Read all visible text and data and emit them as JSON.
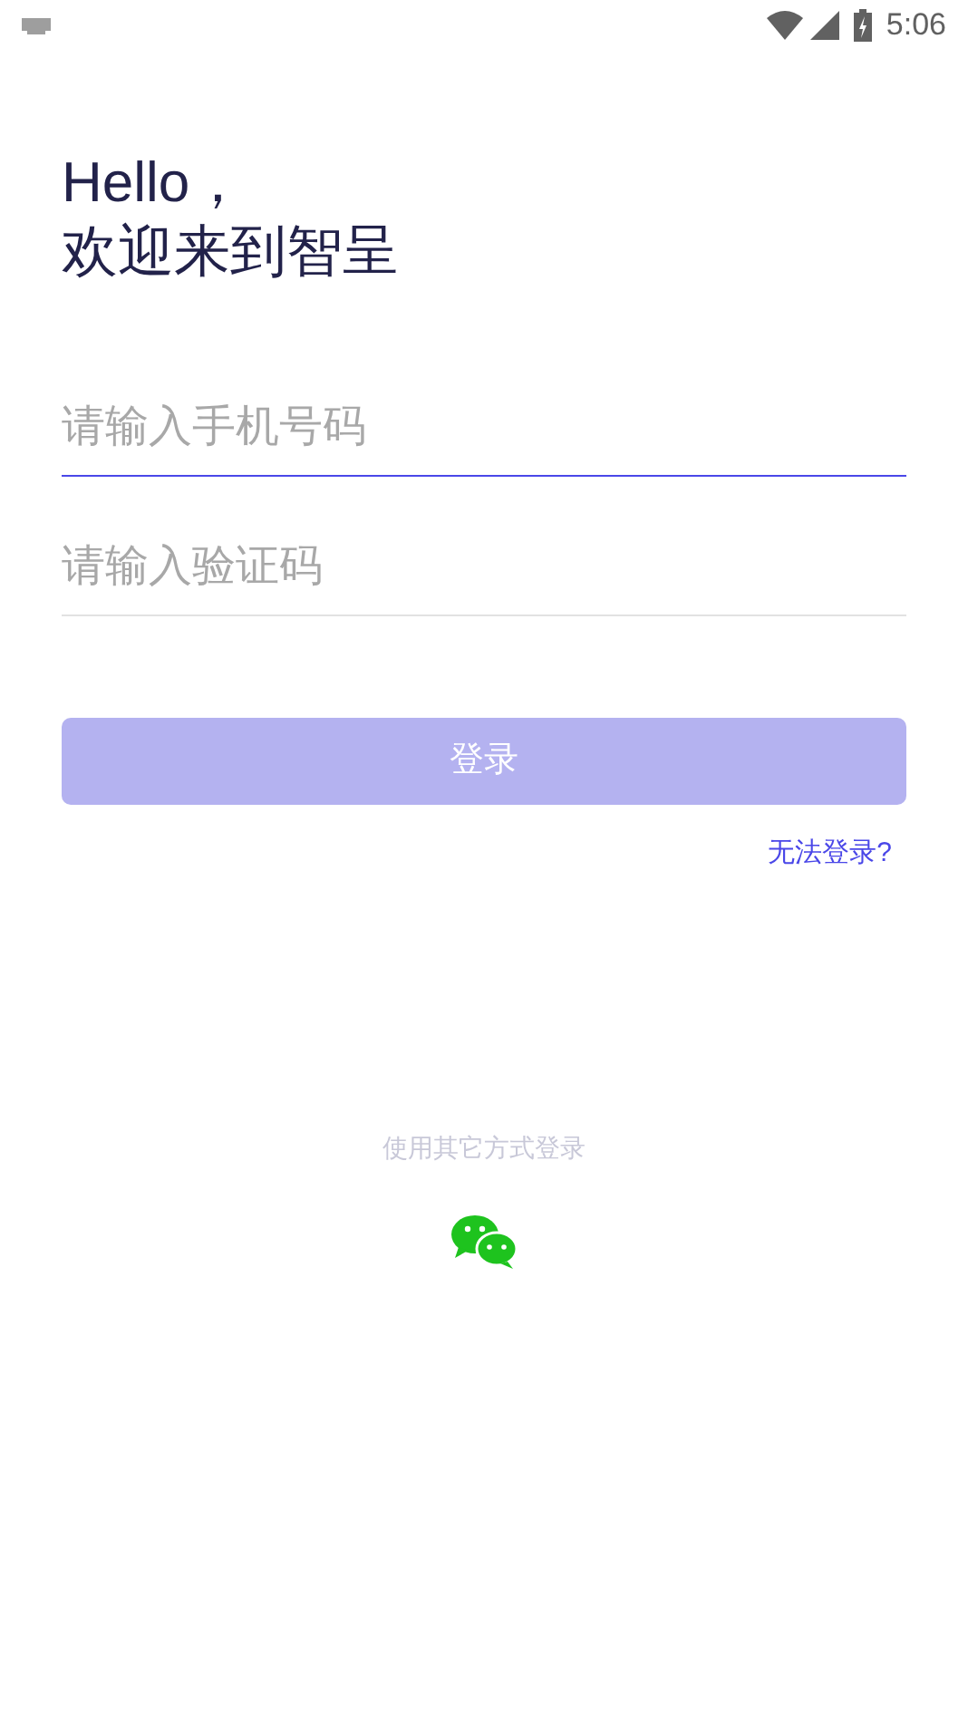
{
  "status_bar": {
    "time": "5:06"
  },
  "greeting": {
    "line_1": "Hello，",
    "line_2": "欢迎来到智呈"
  },
  "fields": [
    {
      "placeholder": "请输入手机号码",
      "focused": true
    },
    {
      "placeholder": "请输入验证码",
      "focused": false
    }
  ],
  "login_button": {
    "label": "登录",
    "disabled": true
  },
  "help_link": "无法登录?",
  "other_login": {
    "label": "使用其它方式登录"
  }
}
